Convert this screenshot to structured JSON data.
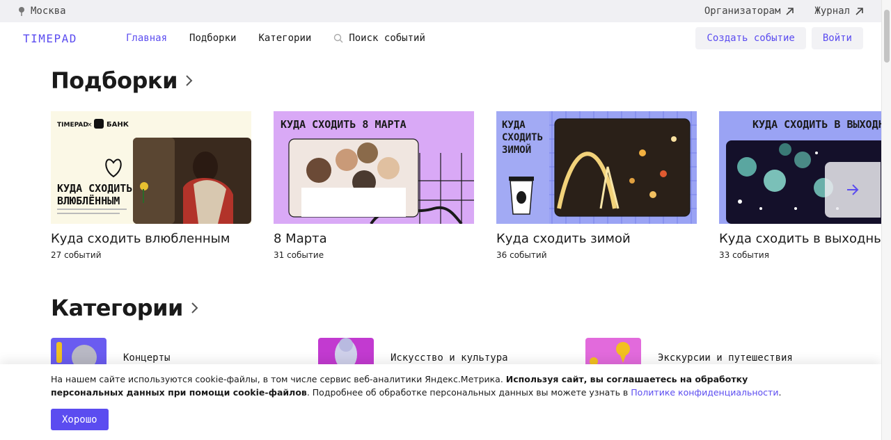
{
  "topbar": {
    "city": "Москва",
    "links": [
      "Организаторам",
      "Журнал"
    ]
  },
  "header": {
    "logo": "TIMEPAD",
    "nav": [
      "Главная",
      "Подборки",
      "Категории"
    ],
    "search_label": "Поиск событий",
    "create_button": "Создать событие",
    "login_button": "Войти"
  },
  "collections": {
    "heading": "Подборки",
    "cards": [
      {
        "title": "Куда сходить влюбленным",
        "count": "27 событий",
        "banner_text": "КУДА СХОДИТЬ ВЛЮБЛЁННЫМ",
        "brand_left": "TIMEPAD",
        "brand_right": "БАНК"
      },
      {
        "title": "8 Марта",
        "count": "31 событие",
        "banner_text": "КУДА СХОДИТЬ 8 МАРТА"
      },
      {
        "title": "Куда сходить зимой",
        "count": "36 событий",
        "banner_text": "КУДА СХОДИТЬ ЗИМОЙ"
      },
      {
        "title": "Куда сходить в выходные",
        "count": "33 события",
        "banner_text": "КУДА СХОДИТЬ В ВЫХОДНЫЕ"
      }
    ]
  },
  "categories": {
    "heading": "Категории",
    "items": [
      "Концерты",
      "Искусство и культура",
      "Экскурсии и путешествия"
    ]
  },
  "cookie": {
    "text_plain": "На нашем сайте используются cookie-файлы, в том числе сервис веб-аналитики Яндекс.Метрика. ",
    "text_bold": "Используя сайт, вы соглашаетесь на обработку персональных данных при помощи cookie-файлов",
    "text_after": ". Подробнее об обработке персональных данных вы можете узнать в ",
    "link": "Политике конфиденциальности",
    "end": ".",
    "ok_button": "Хорошо"
  },
  "colors": {
    "accent": "#5b4cf0",
    "topbar_bg": "#f0f0f3"
  }
}
